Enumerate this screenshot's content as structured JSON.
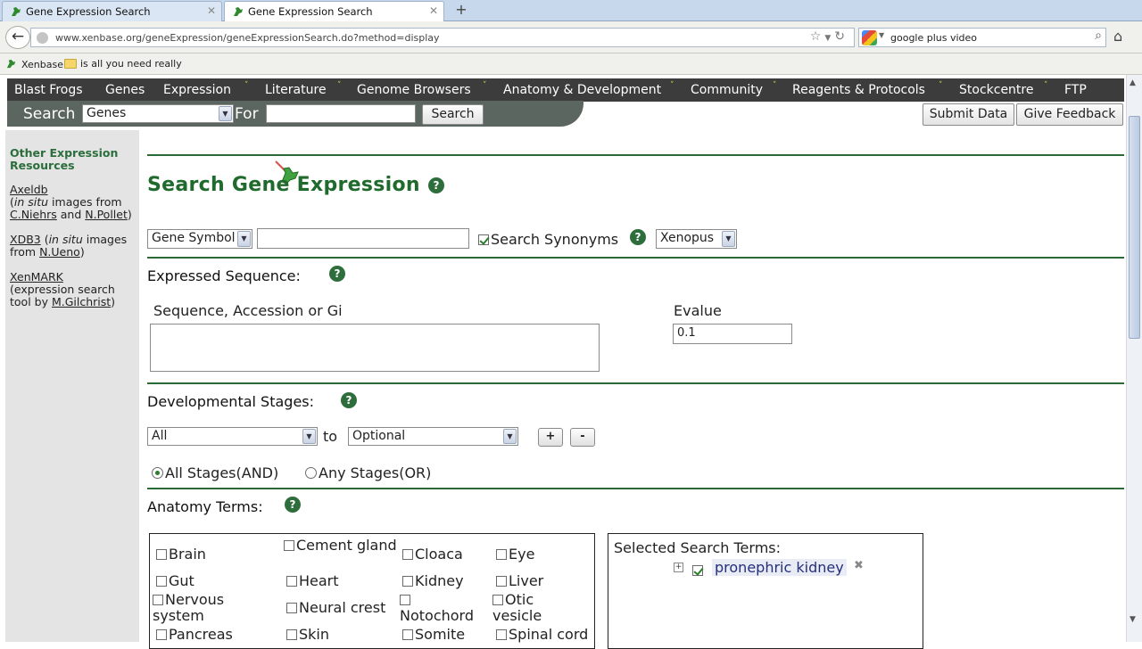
{
  "browser": {
    "tabs": [
      {
        "title": "Gene Expression Search"
      },
      {
        "title": "Gene Expression Search"
      }
    ],
    "url": "www.xenbase.org/geneExpression/geneExpressionSearch.do?method=display",
    "search_value": "google plus video",
    "bookmarks": [
      "Xenbase",
      "is all you need really"
    ]
  },
  "site_nav": {
    "items": [
      "Blast Frogs",
      "Genes",
      "Expression",
      "Literature",
      "Genome Browsers",
      "Anatomy & Development",
      "Community",
      "Reagents & Protocols",
      "Stockcentre",
      "FTP"
    ]
  },
  "search_strip": {
    "search_label": "Search",
    "type_value": "Genes",
    "for_label": "For",
    "query_value": "",
    "button": "Search"
  },
  "header_buttons": {
    "submit": "Submit Data",
    "feedback": "Give Feedback"
  },
  "sidebar": {
    "heading": "Other Expression Resources",
    "axeldb": {
      "name": "Axeldb",
      "open": "(",
      "insitu": "in situ",
      "mid": " images from ",
      "author1": "C.Niehrs",
      "and": " and ",
      "author2": "N.Pollet",
      "close": ")"
    },
    "xdb3": {
      "name": "XDB3",
      "open": " (",
      "insitu": "in situ",
      "mid": " images from ",
      "author": "N.Ueno",
      "close": ")"
    },
    "xenmark": {
      "name": "XenMARK",
      "desc": "(expression search tool by ",
      "author": "M.Gilchrist",
      "close": ")"
    }
  },
  "main": {
    "title": "Search Gene Expression",
    "gene_symbol_select": "Gene Symbol",
    "gene_input_value": "",
    "search_synonyms": "Search Synonyms",
    "species_select": "Xenopus",
    "expressed_sequence": {
      "heading": "Expressed Sequence:",
      "seq_label": "Sequence, Accession or Gi",
      "evalue_label": "Evalue",
      "evalue_value": "0.1"
    },
    "dev_stages": {
      "heading": "Developmental Stages:",
      "from_value": "All",
      "to_label": "to",
      "to_value": "Optional",
      "plus": "+",
      "minus": "-",
      "all_stages": "All Stages",
      "and": "(AND)",
      "any_stages": "Any Stages",
      "or": "(OR)"
    },
    "anatomy": {
      "heading": "Anatomy Terms:",
      "terms": [
        "Brain",
        "Cement gland",
        "Cloaca",
        "Eye",
        "Gut",
        "Heart",
        "Kidney",
        "Liver",
        "Nervous system",
        "Neural crest",
        "Notochord",
        "Otic vesicle",
        "Pancreas",
        "Skin",
        "Somite",
        "Spinal cord"
      ],
      "selected_label": "Selected Search Terms:",
      "selected_term": "pronephric kidney",
      "expand": "+",
      "remove": "✖"
    }
  }
}
